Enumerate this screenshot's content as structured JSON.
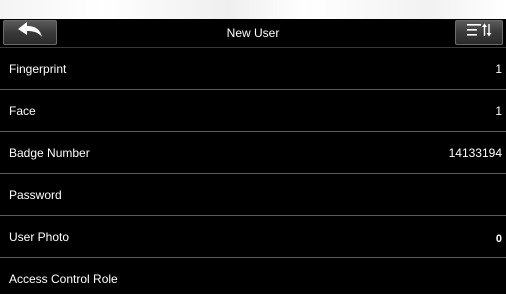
{
  "header": {
    "title": "New User",
    "back_icon": "back-arrow-icon",
    "menu_icon": "sort-menu-icon"
  },
  "rows": [
    {
      "label": "Fingerprint",
      "value": "1"
    },
    {
      "label": "Face",
      "value": "1"
    },
    {
      "label": "Badge Number",
      "value": "14133194"
    },
    {
      "label": "Password",
      "value": ""
    },
    {
      "label": "User Photo",
      "value": "0"
    },
    {
      "label": "Access Control Role",
      "value": ""
    }
  ],
  "colors": {
    "background": "#000000",
    "text": "#ffffff",
    "divider": "#5c5c5c"
  }
}
